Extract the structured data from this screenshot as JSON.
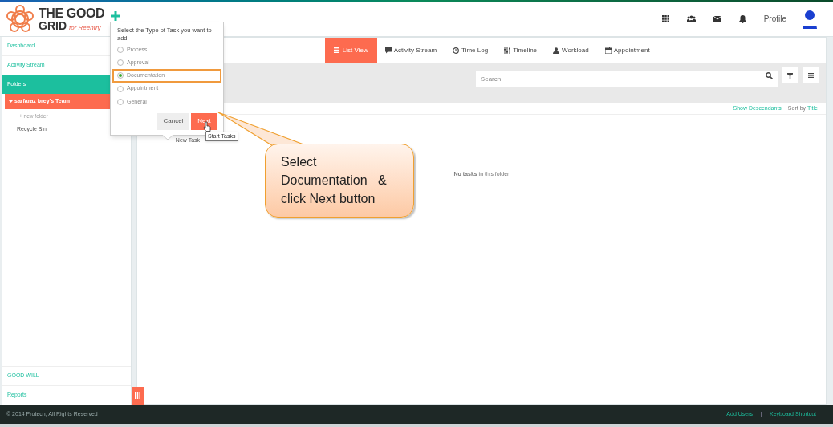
{
  "logo": {
    "line1": "THE GOOD",
    "line2": "GRID",
    "tagline": "for Reentry"
  },
  "header": {
    "profile": "Profile"
  },
  "sidebar": {
    "items": [
      {
        "label": "Dashboard",
        "kind": "link"
      },
      {
        "label": "Activity Stream",
        "kind": "link"
      },
      {
        "label": "Folders",
        "kind": "section"
      },
      {
        "label": "sarfaraz brey's Team",
        "kind": "team",
        "expanded": true
      },
      {
        "label": "+ new folder",
        "kind": "new"
      },
      {
        "label": "Recycle Bin",
        "kind": "plain"
      }
    ],
    "bottom": [
      "GOOD WILL",
      "Reports"
    ]
  },
  "tabs": [
    {
      "label": "List View",
      "selected": true
    },
    {
      "label": "Activity Stream",
      "selected": false
    },
    {
      "label": "Time Log",
      "selected": false
    },
    {
      "label": "Timeline",
      "selected": false
    },
    {
      "label": "Workload",
      "selected": false
    },
    {
      "label": "Appointment",
      "selected": false
    }
  ],
  "search": {
    "placeholder": "Search"
  },
  "list_options": {
    "show_descendants": "Show Descendants",
    "sort_label": "Sort by",
    "sort_value": "Title"
  },
  "new_task": "New Task",
  "empty_message": "**No tasks** in this folder",
  "popup": {
    "title": "Select the Type of Task you want to add:",
    "options": [
      {
        "label": "Process",
        "selected": false,
        "highlighted": false
      },
      {
        "label": "Approval",
        "selected": false,
        "highlighted": false
      },
      {
        "label": "Documentation",
        "selected": true,
        "highlighted": true
      },
      {
        "label": "Appointment",
        "selected": false,
        "highlighted": false
      },
      {
        "label": "General",
        "selected": false,
        "highlighted": false
      }
    ],
    "cancel": "Cancel",
    "next": "Next",
    "tooltip": "Start Tasks"
  },
  "callout": {
    "lines": [
      "Select",
      "Documentation   &",
      "click Next button"
    ]
  },
  "footer": {
    "copyright": "© 2014 Protech, All Rights Reserved",
    "links": [
      "Add Users",
      "Keyboard Shortcut"
    ]
  }
}
